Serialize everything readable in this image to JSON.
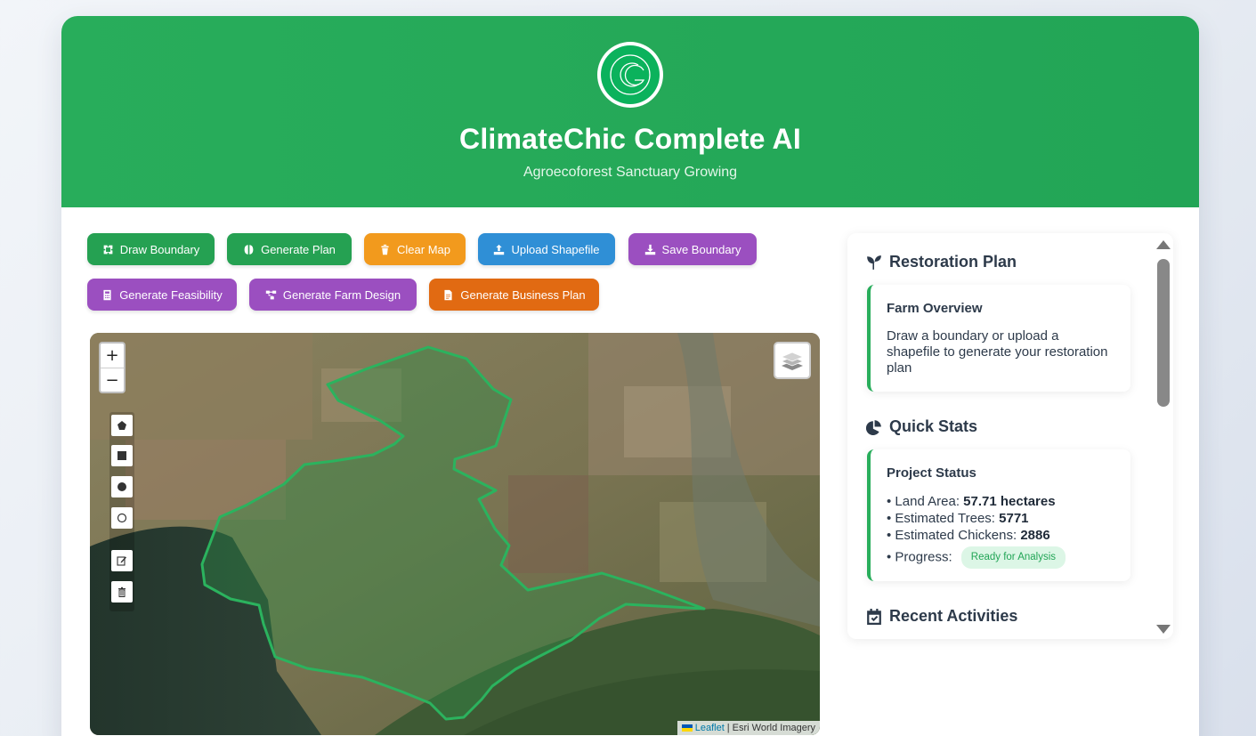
{
  "header": {
    "title": "ClimateChic Complete AI",
    "subtitle": "Agroecoforest Sanctuary Growing",
    "logo_icon": "climatechic-logo-icon",
    "brand_color": "#28ad5b"
  },
  "toolbar": {
    "draw_boundary": "Draw Boundary",
    "generate_plan": "Generate Plan",
    "clear_map": "Clear Map",
    "upload_shapefile": "Upload Shapefile",
    "save_boundary": "Save Boundary",
    "generate_feasibility": "Generate Feasibility",
    "generate_farm_design": "Generate Farm Design",
    "generate_business_plan": "Generate Business Plan"
  },
  "map": {
    "zoom_in": "+",
    "zoom_out": "−",
    "attribution_link": "Leaflet",
    "attribution_rest": "| Esri World Imagery",
    "boundary_color": "#2bb35e"
  },
  "panel": {
    "restoration_title": "Restoration Plan",
    "farm_overview_title": "Farm Overview",
    "farm_overview_text": "Draw a boundary or upload a shapefile to generate your restoration plan",
    "quick_stats_title": "Quick Stats",
    "project_status_title": "Project Status",
    "stats": {
      "land_area_label": "• Land Area: ",
      "land_area_value": "57.71 hectares",
      "trees_label": "• Estimated Trees: ",
      "trees_value": "5771",
      "chickens_label": "• Estimated Chickens: ",
      "chickens_value": "2886",
      "progress_label": "• Progress: ",
      "progress_value": "Ready for Analysis"
    },
    "recent_activities_title": "Recent Activities"
  }
}
